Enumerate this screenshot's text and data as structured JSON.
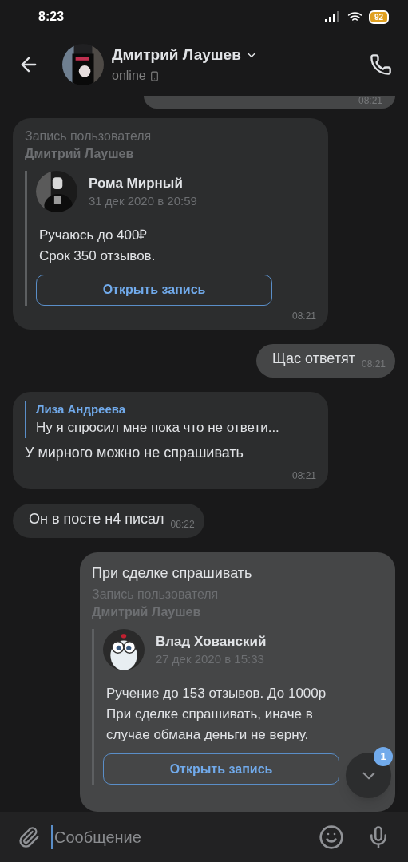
{
  "status_bar": {
    "time": "8:23",
    "battery": "92"
  },
  "header": {
    "name": "Дмитрий Лаушев",
    "status": "online"
  },
  "top_fragment": {
    "time": "08:21"
  },
  "messages": [
    {
      "kind": "in",
      "post": {
        "caption": "Запись пользователя",
        "owner": "Дмитрий Лаушев",
        "author": "Рома Мирный",
        "date": "31 дек 2020 в 20:59",
        "body": "Ручаюсь до 400₽\nСрок 350 отзывов.",
        "button": "Открыть запись"
      },
      "time": "08:21"
    },
    {
      "kind": "out",
      "text": "Щас ответят",
      "time": "08:21"
    },
    {
      "kind": "in",
      "reply": {
        "author": "Лиза Андреева",
        "text": "Ну я спросил мне пока что не ответи..."
      },
      "text": "У мирного можно не спрашивать",
      "time": "08:21"
    },
    {
      "kind": "in",
      "text": "Он в посте н4 писал",
      "time": "08:22"
    },
    {
      "kind": "out",
      "text": "При сделке спрашивать",
      "post": {
        "caption": "Запись пользователя",
        "owner": "Дмитрий Лаушев",
        "author": "Влад Хованский",
        "date": "27 дек 2020 в 15:33",
        "body": "Ручение до 153 отзывов. До 1000р\nПри сделке спрашивать, иначе в\nслучае обмана деньги не верну.",
        "button": "Открыть запись"
      }
    }
  ],
  "scroll_button": {
    "badge": "1"
  },
  "composer": {
    "placeholder": "Сообщение"
  }
}
